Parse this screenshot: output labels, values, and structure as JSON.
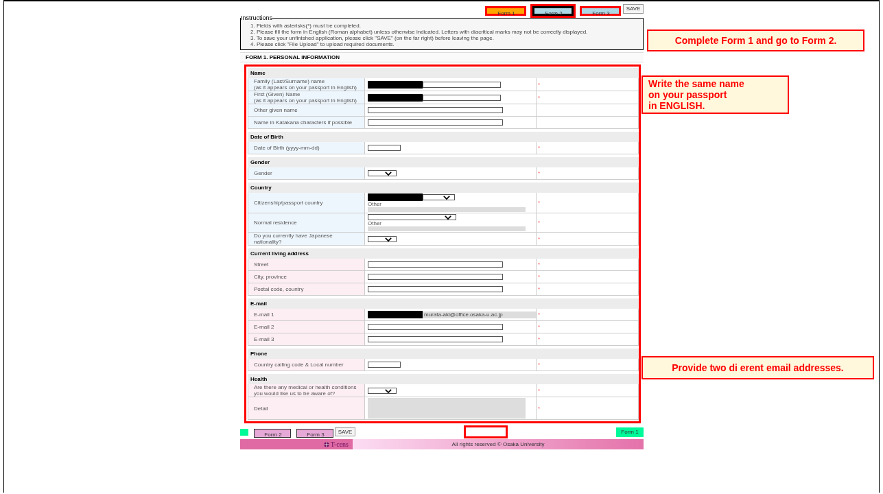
{
  "nav_buttons": [
    {
      "label": "Form 1",
      "kind": "form",
      "color": "#ffa500",
      "highlighted": false
    },
    {
      "label": "Form 2",
      "kind": "form",
      "color": "#add8e6",
      "highlighted": true
    },
    {
      "label": "Form 3",
      "kind": "form",
      "color": "#add8e6",
      "highlighted": false
    },
    {
      "label": "SAVE",
      "kind": "save",
      "color": "#f4f4f4",
      "highlighted": false
    }
  ],
  "instructions": {
    "title": "Instructions",
    "items": [
      "1. Fields with asterisks(*) must be completed.",
      "2. Please fill the form in English (Roman alphabet) unless otherwise indicated. Letters with diacritical marks may not be correctly displayed.",
      "3. To save your unfinished application, please click \"SAVE\" (on the far right) before leaving the page.",
      "4. Please click \"File Upload\" to upload required documents."
    ]
  },
  "form_title": "FORM 1. PERSONAL INFORMATION",
  "sections": [
    {
      "title": "Name",
      "color": "#eef6fd",
      "rows": [
        {
          "label": "Family (Last/Surname) name",
          "sublabel": "(as it appears on your passport in English)",
          "kind": "text",
          "redacted": true,
          "note": "*"
        },
        {
          "label": "First (Given) Name",
          "sublabel": "(as it appears on your passport in English)",
          "kind": "text",
          "redacted": true,
          "note": "*"
        },
        {
          "label": "Other given name",
          "kind": "text",
          "redacted": false
        },
        {
          "label": "Name in Katakana characters if possible",
          "kind": "text",
          "redacted": false
        }
      ]
    },
    {
      "title": "Date of Birth",
      "color": "#eef6fd",
      "rows": [
        {
          "label": "Date of Birth    (yyyy-mm-dd)",
          "kind": "short",
          "redacted": false,
          "note": "*"
        }
      ]
    },
    {
      "title": "Gender",
      "color": "#eef6fd",
      "rows": [
        {
          "label": "Gender",
          "kind": "select",
          "redacted": false,
          "note": "*"
        }
      ]
    },
    {
      "title": "Country",
      "color": "#eef6fd",
      "rows": [
        {
          "label": "Citizenship/passport country",
          "kind": "select_other",
          "other": "Other",
          "redacted": true,
          "note": "*"
        },
        {
          "label": "Normal residence",
          "kind": "select_other",
          "other": "Other",
          "redacted": false,
          "note": "*"
        },
        {
          "label": "Do you currently have Japanese nationality?",
          "kind": "select",
          "redacted": false,
          "note": "*"
        }
      ]
    },
    {
      "title": "Current living address",
      "color": "#fdeef4",
      "rows": [
        {
          "label": "Street",
          "kind": "text",
          "redacted": false,
          "note": "*"
        },
        {
          "label": "City, province",
          "kind": "text",
          "redacted": false,
          "note": "*"
        },
        {
          "label": "Postal code, country",
          "kind": "text",
          "redacted": false,
          "note": "*"
        }
      ]
    },
    {
      "title": "E-mail",
      "color": "#fdeef4",
      "rows": [
        {
          "label": "E-mail 1",
          "kind": "readonly",
          "value": "murata-aki@office.osaka-u.ac.jp",
          "redacted": true,
          "note": "*"
        },
        {
          "label": "E-mail 2",
          "kind": "text",
          "redacted": false,
          "note": "*"
        },
        {
          "label": "E-mail 3",
          "kind": "text",
          "redacted": false,
          "note": "*"
        }
      ]
    },
    {
      "title": "Phone",
      "color": "#fdeef4",
      "rows": [
        {
          "label": "Country calling code & Local number",
          "kind": "short",
          "redacted": false,
          "note": "*"
        }
      ]
    },
    {
      "title": "Health",
      "color": "#fdeef4",
      "rows": [
        {
          "label": "Are there any medical or health conditions you would like us to be aware of?",
          "kind": "select",
          "redacted": false,
          "note": "*"
        },
        {
          "label": "Detail",
          "kind": "textarea",
          "redacted": false,
          "note": "*"
        }
      ]
    }
  ],
  "bottom_buttons": [
    {
      "label": "Form 2",
      "kind": "form",
      "color": "#e6a8d7"
    },
    {
      "label": "Form 3",
      "kind": "form",
      "color": "#e6a8d7"
    },
    {
      "label": "SAVE",
      "kind": "save",
      "color": "#f4f4f4"
    }
  ],
  "bottom_right_button": {
    "label": "Form 1",
    "color": "#00fa9a"
  },
  "footer": {
    "logo": "T-cens",
    "copyright": "All rights reserved © Osaka University"
  },
  "annotations": [
    {
      "lines": [
        "Complete Form 1 and go to Form 2."
      ]
    },
    {
      "lines": [
        "Write the same name",
        "on your passport",
        "in ENGLISH."
      ]
    },
    {
      "lines": [
        "Provide two di erent email addresses."
      ]
    }
  ]
}
